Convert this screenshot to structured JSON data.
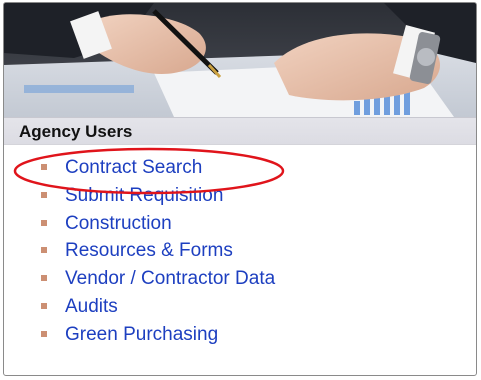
{
  "header": {
    "title": "Agency Users"
  },
  "menu": {
    "items": [
      {
        "label": "Contract Search"
      },
      {
        "label": "Submit Requisition"
      },
      {
        "label": "Construction"
      },
      {
        "label": "Resources & Forms"
      },
      {
        "label": "Vendor / Contractor Data"
      },
      {
        "label": "Audits"
      },
      {
        "label": "Green Purchasing"
      }
    ]
  },
  "colors": {
    "link": "#1d3fc0",
    "bullet": "#cc8f73",
    "highlight": "#e0141b",
    "header_bg": "#e0e0e6"
  },
  "icons": {
    "bullet": "square-bullet-icon",
    "highlight": "red-ellipse-annotation"
  }
}
